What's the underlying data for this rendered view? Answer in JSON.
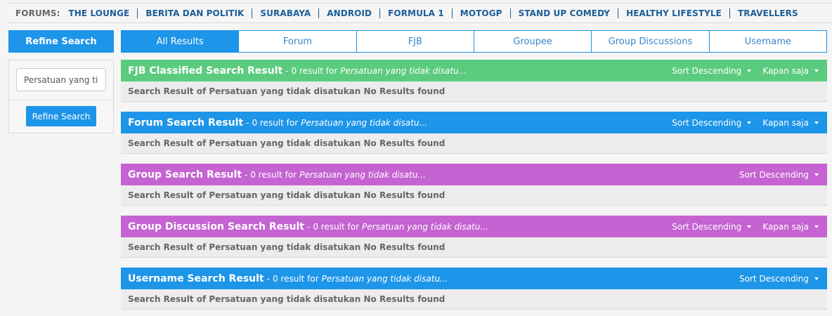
{
  "forums": {
    "label": "FORUMS:",
    "links": [
      "THE LOUNGE",
      "BERITA DAN POLITIK",
      "SURABAYA",
      "ANDROID",
      "FORMULA 1",
      "MOTOGP",
      "STAND UP COMEDY",
      "HEALTHY LIFESTYLE",
      "TRAVELLERS"
    ]
  },
  "sidebar": {
    "header": "Refine Search",
    "search_value": "Persatuan yang tidak disatukan",
    "button_label": "Refine Search"
  },
  "tabs": [
    {
      "label": "All Results",
      "active": true
    },
    {
      "label": "Forum",
      "active": false
    },
    {
      "label": "FJB",
      "active": false
    },
    {
      "label": "Groupee",
      "active": false
    },
    {
      "label": "Group Discussions",
      "active": false
    },
    {
      "label": "Username",
      "active": false
    }
  ],
  "results": [
    {
      "title": "FJB Classified Search Result",
      "dash": "-",
      "count": "0 result for",
      "query": "Persatuan yang tidak disatu...",
      "sort_label": "Sort Descending",
      "time_label": "Kapan saja",
      "color": "green",
      "body": "Search Result of Persatuan yang tidak disatukan No Results found"
    },
    {
      "title": "Forum Search Result",
      "dash": "-",
      "count": "0 result for",
      "query": "Persatuan yang tidak disatu...",
      "sort_label": "Sort Descending",
      "time_label": "Kapan saja",
      "color": "blue",
      "body": "Search Result of Persatuan yang tidak disatukan No Results found"
    },
    {
      "title": "Group Search Result",
      "dash": "-",
      "count": "0 result for",
      "query": "Persatuan yang tidak disatu...",
      "sort_label": "Sort Descending",
      "time_label": null,
      "color": "purple",
      "body": "Search Result of Persatuan yang tidak disatukan No Results found"
    },
    {
      "title": "Group Discussion Search Result",
      "dash": "-",
      "count": "0 result for",
      "query": "Persatuan yang tidak disatu...",
      "sort_label": "Sort Descending",
      "time_label": "Kapan saja",
      "color": "purple",
      "body": "Search Result of Persatuan yang tidak disatukan No Results found"
    },
    {
      "title": "Username Search Result",
      "dash": "-",
      "count": "0 result for",
      "query": "Persatuan yang tidak disatu...",
      "sort_label": "Sort Descending",
      "time_label": null,
      "color": "blue",
      "body": "Search Result of Persatuan yang tidak disatukan No Results found"
    }
  ],
  "colors": {
    "green": "#5bcb7e",
    "blue": "#1d95e8",
    "purple": "#c463d1",
    "link": "#1b5e99"
  }
}
